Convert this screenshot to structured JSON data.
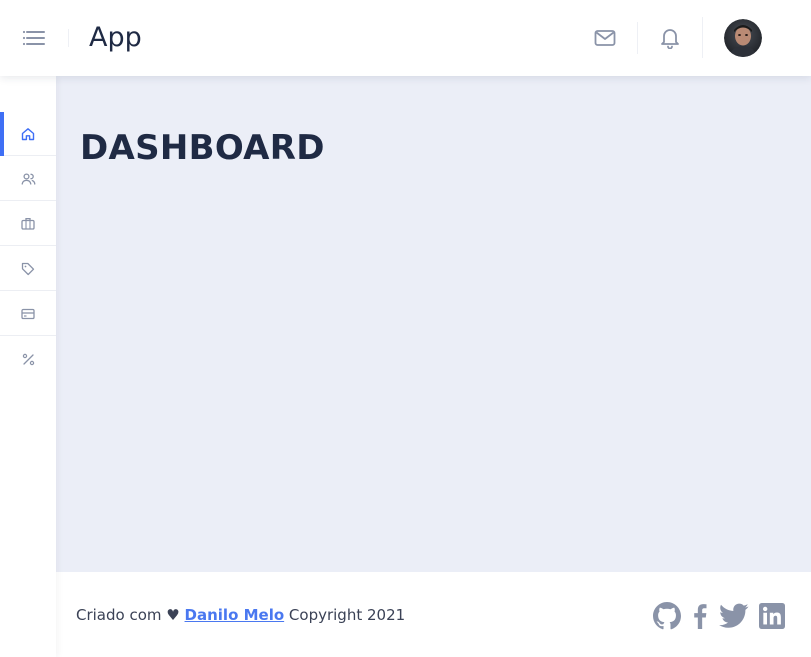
{
  "header": {
    "title": "App",
    "icons": {
      "menu": "menu-icon",
      "mail": "mail-icon",
      "notifications": "bell-icon",
      "avatar": "user-avatar"
    }
  },
  "sidebar": {
    "items": [
      {
        "icon": "home-icon",
        "active": true
      },
      {
        "icon": "users-icon",
        "active": false
      },
      {
        "icon": "briefcase-icon",
        "active": false
      },
      {
        "icon": "tag-icon",
        "active": false
      },
      {
        "icon": "credit-card-icon",
        "active": false
      },
      {
        "icon": "percent-icon",
        "active": false
      }
    ]
  },
  "main": {
    "title": "DASHBOARD"
  },
  "footer": {
    "made_with": "Criado com",
    "heart": "♥",
    "author": "Danilo Melo",
    "copyright": "Copyright 2021",
    "social": [
      "github-icon",
      "facebook-icon",
      "twitter-icon",
      "linkedin-icon"
    ]
  },
  "colors": {
    "accent": "#3f6ff5",
    "link": "#4a78f0",
    "content_bg": "#ebeef7",
    "text": "#1f2a44",
    "icon": "#8a93a8"
  }
}
